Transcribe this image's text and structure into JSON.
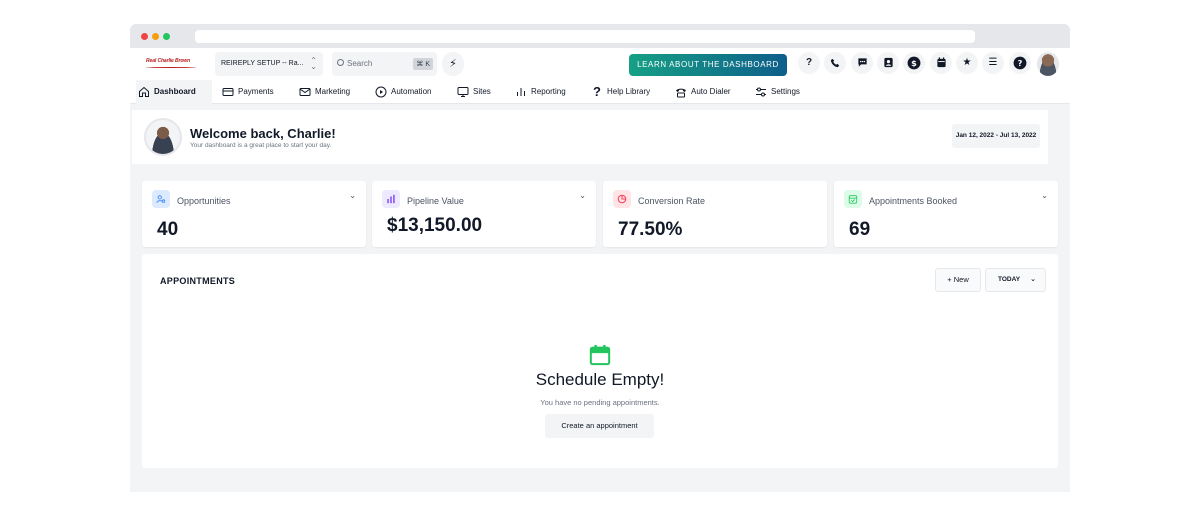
{
  "topbar": {
    "logo_text": "Real Charlie Brown",
    "account_label": "REIREPLY SETUP -- Ra...",
    "search_placeholder": "Search",
    "search_shortcut": "⌘ K",
    "learn_button": "LEARN ABOUT THE DASHBOARD",
    "icons": [
      "help-icon",
      "phone-icon",
      "chat-icon",
      "contact-icon",
      "dollar-icon",
      "calendar-icon",
      "star-icon",
      "list-icon",
      "question-circle-icon"
    ]
  },
  "nav": {
    "items": [
      {
        "label": "Dashboard",
        "icon": "home-icon",
        "active": true
      },
      {
        "label": "Payments",
        "icon": "payments-icon"
      },
      {
        "label": "Marketing",
        "icon": "mail-icon"
      },
      {
        "label": "Automation",
        "icon": "play-icon"
      },
      {
        "label": "Sites",
        "icon": "monitor-icon"
      },
      {
        "label": "Reporting",
        "icon": "bar-chart-icon"
      },
      {
        "label": "Help Library",
        "icon": "question-icon"
      },
      {
        "label": "Auto Dialer",
        "icon": "dialer-icon"
      },
      {
        "label": "Settings",
        "icon": "sliders-icon"
      }
    ]
  },
  "welcome": {
    "title": "Welcome back, Charlie!",
    "subtitle": "Your dashboard is a great place to start your day.",
    "date_range": "Jan 12, 2022 - Jul 13, 2022"
  },
  "stats": [
    {
      "label": "Opportunities",
      "value": "40",
      "icon": "user-search-icon",
      "color": "#3b82f6",
      "bg": "#dbeafe"
    },
    {
      "label": "Pipeline Value",
      "value": "$13,150.00",
      "icon": "bars-icon",
      "color": "#8b5cf6",
      "bg": "#ede9fe"
    },
    {
      "label": "Conversion Rate",
      "value": "77.50%",
      "icon": "pie-icon",
      "color": "#f43f5e",
      "bg": "#ffe4e6"
    },
    {
      "label": "Appointments Booked",
      "value": "69",
      "icon": "calendar-check-icon",
      "color": "#22c55e",
      "bg": "#dcfce7"
    }
  ],
  "appointments": {
    "title": "APPOINTMENTS",
    "new_button": "+ New",
    "filter_label": "TODAY",
    "empty_title": "Schedule Empty!",
    "empty_subtitle": "You have no pending appointments.",
    "create_button": "Create an appointment",
    "accent_color": "#22c55e"
  }
}
